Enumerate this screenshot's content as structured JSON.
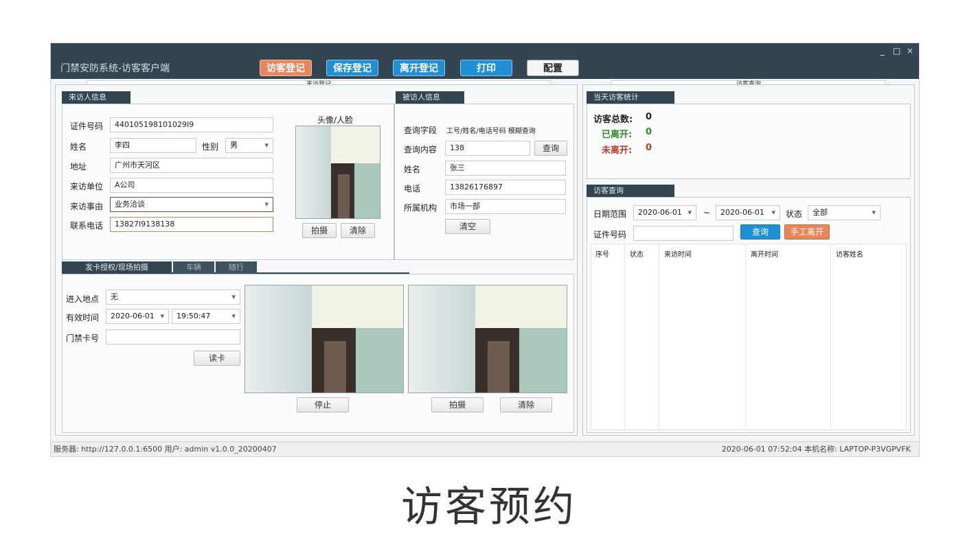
{
  "window": {
    "title": "门禁安防系统-访客客户端",
    "controls": [
      "_",
      "□",
      "×"
    ]
  },
  "toolbar": {
    "register": "访客登记",
    "save": "保存登记",
    "leave": "离开登记",
    "print": "打印",
    "config": "配置"
  },
  "sections": {
    "left_tab": "来访登记",
    "right_tab": "访客查询"
  },
  "visitor": {
    "header": "来访人信息",
    "id_label": "证件号码",
    "id_value": "440105198101029I9",
    "name_label": "姓名",
    "name_value": "李四",
    "gender_label": "性别",
    "gender_value": "男",
    "address_label": "地址",
    "address_value": "广州市天河区",
    "company_label": "来访单位",
    "company_value": "A公司",
    "reason_label": "来访事由",
    "reason_value": "业务洽谈",
    "phone_label": "联系电话",
    "phone_value": "13827I9138138",
    "photo_label": "头像/人脸",
    "capture_btn": "拍摄",
    "clear_btn": "清除"
  },
  "host": {
    "header": "被访人信息",
    "field_label": "查询字段",
    "field_value": "工号/姓名/电话号码 模糊查询",
    "content_label": "查询内容",
    "content_value": "138",
    "query_btn": "查询",
    "name_label": "姓名",
    "name_value": "张三",
    "phone_label": "电话",
    "phone_value": "13826176897",
    "org_label": "所属机构",
    "org_value": "市场一部",
    "clear_btn": "清空"
  },
  "card": {
    "tabs": [
      "发卡授权/现场拍摄",
      "车辆",
      "随行"
    ],
    "location_label": "进入地点",
    "location_value": "无",
    "valid_label": "有效时间",
    "valid_date": "2020-06-01",
    "valid_time": "19:50:47",
    "card_label": "门禁卡号",
    "card_value": "",
    "read_btn": "读卡",
    "stop_btn": "停止",
    "capture_btn": "拍摄",
    "clear_btn": "清除"
  },
  "stats": {
    "header": "当天访客统计",
    "total_label": "访客总数:",
    "total_value": "0",
    "left_label": "已离开:",
    "left_value": "0",
    "stay_label": "未离开:",
    "stay_value": "0",
    "colors": {
      "left": "#2e8b2e",
      "stay": "#c0392b"
    }
  },
  "query": {
    "header": "访客查询",
    "date_label": "日期范围",
    "date_from": "2020-06-01",
    "tilde": "~",
    "date_to": "2020-06-01",
    "status_label": "状态",
    "status_value": "全部",
    "id_label": "证件号码",
    "id_value": "",
    "query_btn": "查询",
    "manual_btn": "手工离开",
    "columns": [
      "序号",
      "状态",
      "来访时间",
      "离开时间",
      "访客姓名"
    ]
  },
  "status_bar": {
    "left": "服务器:  http://127.0.0.1:6500   用户:  admin   v1.0.0_20200407",
    "right": "2020-06-01 07:52:04   本机名称:  LAPTOP-P3VGPVFK"
  },
  "caption": "访客预约",
  "accent_colors": {
    "orange": "#e8865a",
    "blue": "#1f8fd6",
    "dark": "#324550"
  }
}
